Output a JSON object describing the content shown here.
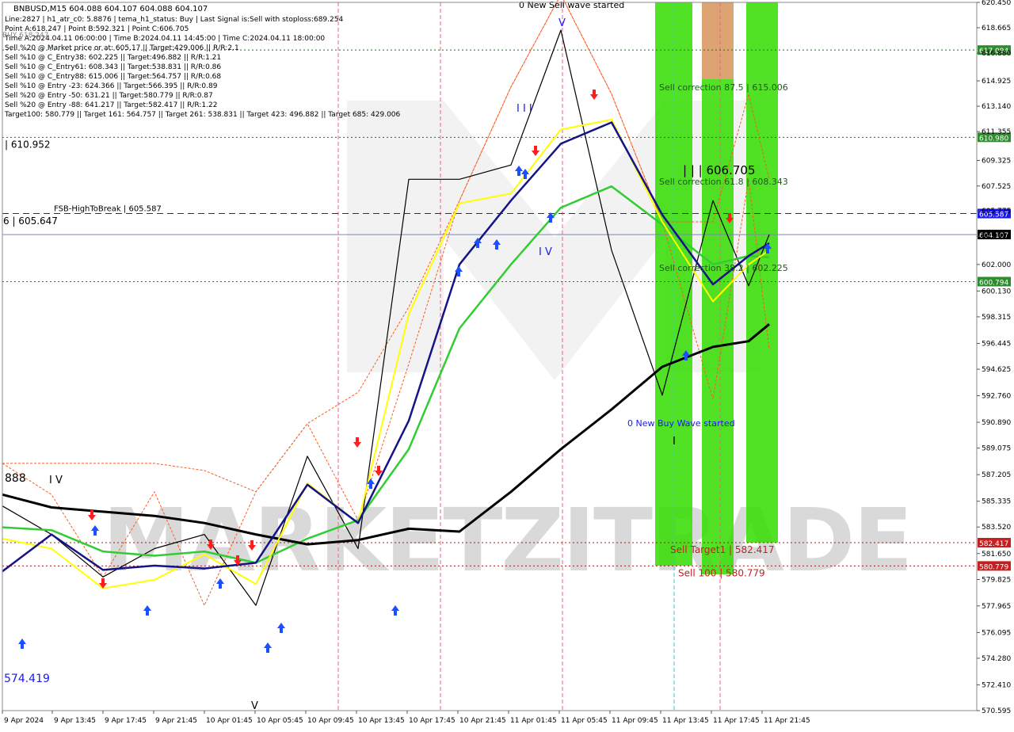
{
  "header": {
    "symbol_line": "BNBUSD,M15  604.088 604.107 604.088 604.107",
    "info_lines": [
      "Line:2827  |  h1_atr_c0: 5.8876  |  tema_h1_status: Buy  |  Last Signal is:Sell with stoploss:689.254",
      "Point A:618.247  |  Point B:592.321  |  Point C:606.705",
      "Time A:2024.04.11 06:00:00  |  Time B:2024.04.11 14:45:00  |  Time C:2024.04.11 18:00:00",
      "Sell %20 @ Market price or at: 605.17  ||  Target:429.006  ||  R/R:2.1",
      "Sell %10 @ C_Entry38: 602.225  ||  Target:496.882  ||  R/R:1.21",
      "Sell %10 @ C_Entry61: 608.343  ||  Target:538.831  ||  R/R:0.86",
      "Sell %10 @ C_Entry88: 615.006  ||  Target:564.757  ||  R/R:0.68",
      "Sell %10 @ Entry -23: 624.366  ||  Target:566.395  ||  R/R:0.89",
      "Sell %20 @ Entry -50: 631.21  ||  Target:580.779  ||  R/R:0.87",
      "Sell %20 @ Entry -88: 641.217  ||  Target:582.417  ||  R/R:1.22",
      "Target100: 580.779  ||  Target 161: 564.757  ||  Target 261: 538.831  ||  Target 423: 496.882  ||  Target 685: 429.006"
    ],
    "overlap_text": "BUY 618.247"
  },
  "watermark": "MARKETZITRADE",
  "colors": {
    "background": "#ffffff",
    "border": "#888888",
    "grid": "#ffffff",
    "sma_black": "#000000",
    "ema_navy": "#141486",
    "ema_yellow": "#ffff00",
    "ema_green": "#33cc33",
    "bands_orange": "#ff5a1e",
    "up_arrow": "#1b4fff",
    "down_arrow": "#ff1e1e",
    "zone_green": "#33dd00",
    "zone_orange": "#d8935a",
    "dashed_blue": "#1a1aee",
    "green_dotted": "#1c7a1c",
    "red_dotted": "#a01e1e",
    "pink_vline": "#ff5b8c",
    "cyan_vline": "#33cccc",
    "current_price_line": "#7d87b4"
  },
  "chart_data": {
    "type": "line",
    "title": "BNBUSD,M15",
    "y_range": [
      570.595,
      620.45
    ],
    "y_ticks": [
      "620.450",
      "618.665",
      "616.880",
      "614.925",
      "613.140",
      "611.355",
      "609.325",
      "607.525",
      "605.775",
      "603.990",
      "602.000",
      "600.130",
      "598.315",
      "596.445",
      "594.625",
      "592.760",
      "590.890",
      "589.075",
      "587.205",
      "585.335",
      "583.520",
      "581.650",
      "579.825",
      "577.965",
      "576.095",
      "574.280",
      "572.410",
      "570.595"
    ],
    "x_ticks": [
      "9 Apr 2024",
      "9 Apr 13:45",
      "9 Apr 17:45",
      "9 Apr 21:45",
      "10 Apr 01:45",
      "10 Apr 05:45",
      "10 Apr 09:45",
      "10 Apr 13:45",
      "10 Apr 17:45",
      "10 Apr 21:45",
      "11 Apr 01:45",
      "11 Apr 05:45",
      "11 Apr 09:45",
      "11 Apr 13:45",
      "11 Apr 17:45",
      "11 Apr 21:45"
    ],
    "series": [
      {
        "name": "sma_black",
        "values": [
          585.8,
          584.9,
          584.6,
          584.3,
          583.8,
          583.0,
          582.3,
          582.6,
          583.4,
          583.2,
          586.0,
          589.0,
          591.8,
          594.8,
          596.2,
          596.6,
          597.8
        ]
      },
      {
        "name": "ema_navy",
        "values": [
          580.4,
          583.0,
          580.5,
          580.8,
          580.6,
          581.0,
          586.5,
          583.8,
          591.0,
          602.0,
          606.5,
          610.5,
          612.0,
          605.5,
          600.6,
          602.6,
          603.5
        ]
      },
      {
        "name": "ema_yellow",
        "values": [
          582.7,
          582.0,
          579.2,
          579.8,
          581.6,
          579.5,
          586.6,
          583.8,
          598.5,
          606.3,
          607.0,
          611.5,
          612.2,
          605.0,
          599.4,
          602.0,
          603.0
        ]
      },
      {
        "name": "ema_green",
        "values": [
          583.5,
          583.3,
          581.8,
          581.5,
          581.8,
          581.0,
          582.7,
          584.0,
          589.0,
          597.5,
          602.0,
          606.0,
          607.5,
          604.8,
          602.0,
          602.6,
          602.5
        ]
      },
      {
        "name": "bands_orange",
        "values": [
          588.0,
          585.8,
          580.0,
          586.0,
          578.0,
          586.0,
          590.8,
          584.0,
          595.0,
          606.5,
          614.5,
          621.0,
          614.0,
          605.0,
          592.5,
          608.0,
          596.0
        ]
      },
      {
        "name": "bands_orange_upper",
        "values": [
          588.0,
          588.0,
          588.0,
          588.0,
          587.5,
          586.0,
          590.8,
          593.0,
          599.0,
          606.5,
          614.5,
          621.0,
          614.0,
          605.0,
          605.0,
          614.0,
          608.0
        ]
      },
      {
        "name": "price_path",
        "values": [
          585.0,
          583.0,
          580.0,
          582.0,
          583.0,
          578.0,
          588.5,
          582.0,
          608.0,
          608.0,
          609.0,
          618.5,
          603.0,
          592.8,
          606.5,
          600.5,
          604.107
        ]
      }
    ],
    "horizontal_levels": [
      {
        "name": "FSB-HighToBreak",
        "label": "FSB-HighToBreak  |  605.587",
        "value": 605.587,
        "price_tag": "605.587",
        "style": "dashed_blue"
      },
      {
        "name": "current_price",
        "label": "604.107",
        "value": 604.107,
        "price_tag": "604.107",
        "style": "current"
      },
      {
        "name": "level_617",
        "label": "",
        "value": 617.094,
        "price_tag": "617.094",
        "style": "green_dotted"
      },
      {
        "name": "level_610",
        "label": "| 610.952",
        "value": 610.952,
        "price_tag": "610.980",
        "style": "green_dotted"
      },
      {
        "name": "level_600",
        "label": "",
        "value": 600.794,
        "price_tag": "600.794",
        "style": "green_dotted"
      },
      {
        "name": "sell_target_1",
        "label": "Sell Target1 | 582.417",
        "value": 582.417,
        "price_tag": "582.417",
        "style": "red_dotted"
      },
      {
        "name": "sell_100",
        "label": "Sell 100 | 580.779",
        "value": 580.779,
        "price_tag": "580.779",
        "style": "red_dotted"
      }
    ],
    "price_left_labels": [
      "6 | 605.647",
      "888",
      "574.419"
    ],
    "annotations": [
      {
        "name": "new-sell-wave",
        "text": "0 New Sell wave started"
      },
      {
        "name": "new-buy-wave",
        "text": "0 New Buy Wave started"
      },
      {
        "name": "sell-correction-875",
        "text": "Sell correction 87.5 | 615.006"
      },
      {
        "name": "sell-correction-618",
        "text": "Sell correction 61.8 | 608.343"
      },
      {
        "name": "sell-correction-382",
        "text": "Sell correction 38.2 | 602.225"
      },
      {
        "name": "point-c",
        "text": "| | | 606.705"
      },
      {
        "name": "wave-iv-left",
        "text": "I V"
      },
      {
        "name": "wave-iii",
        "text": "I I I"
      },
      {
        "name": "wave-iv-mid",
        "text": "I V"
      },
      {
        "name": "wave-v-top",
        "text": "V"
      },
      {
        "name": "wave-v-bottom",
        "text": "V"
      },
      {
        "name": "wave-i",
        "text": "I"
      }
    ],
    "grid": false,
    "legend": "none"
  }
}
